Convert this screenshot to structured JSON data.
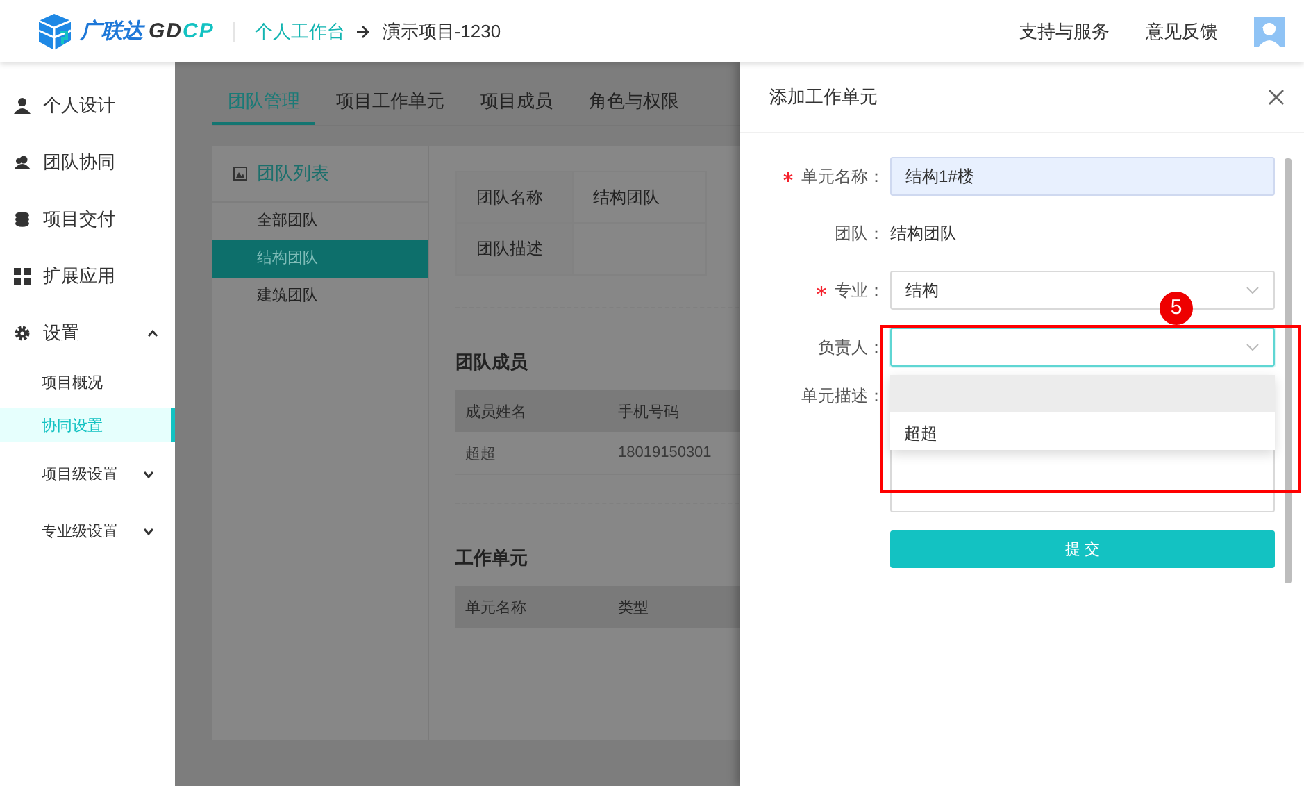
{
  "header": {
    "logo": {
      "brand": "广联达",
      "latin_dark": "GD",
      "latin_accent": "CP"
    },
    "breadcrumb": [
      "个人工作台",
      "演示项目-1230"
    ],
    "links": [
      "支持与服务",
      "意见反馈"
    ]
  },
  "sidebar": {
    "items": [
      {
        "label": "个人设计"
      },
      {
        "label": "团队协同"
      },
      {
        "label": "项目交付"
      },
      {
        "label": "扩展应用"
      },
      {
        "label": "设置",
        "expanded": true,
        "children": [
          {
            "label": "项目概况",
            "selected": false
          },
          {
            "label": "协同设置",
            "selected": true
          },
          {
            "label": "项目级设置",
            "selected": false,
            "expanded": false
          },
          {
            "label": "专业级设置",
            "selected": false,
            "expanded": false
          }
        ]
      }
    ]
  },
  "tabs": [
    {
      "label": "团队管理",
      "selected": true
    },
    {
      "label": "项目工作单元",
      "selected": false
    },
    {
      "label": "项目成员",
      "selected": false
    },
    {
      "label": "角色与权限",
      "selected": false
    }
  ],
  "team_list": {
    "title": "团队列表",
    "items": [
      {
        "label": "全部团队",
        "selected": false
      },
      {
        "label": "结构团队",
        "selected": true
      },
      {
        "label": "建筑团队",
        "selected": false
      }
    ]
  },
  "team_info": [
    {
      "label": "团队名称",
      "value": "结构团队"
    },
    {
      "label": "团队描述"
    }
  ],
  "members": {
    "title": "团队成员",
    "columns": [
      "成员姓名",
      "手机号码"
    ],
    "rows": [
      [
        "超超",
        "18019150301"
      ]
    ]
  },
  "work_units": {
    "title": "工作单元",
    "columns": [
      "单元名称",
      "类型"
    ]
  },
  "drawer": {
    "title": "添加工作单元",
    "fields": [
      {
        "kind": "input",
        "label": "单元名称：",
        "required": true,
        "value": "结构1#楼"
      },
      {
        "kind": "text",
        "label": "团队：",
        "value": "结构团队"
      },
      {
        "kind": "select",
        "label": "专业：",
        "required": true,
        "value": "结构"
      },
      {
        "kind": "select",
        "label": "负责人：",
        "focused": true,
        "options": [
          {
            "highlighted": true
          },
          {
            "label": "超超",
            "highlighted": false
          }
        ]
      },
      {
        "kind": "textarea",
        "label": "单元描述："
      }
    ],
    "submit": "提 交"
  },
  "annotation": {
    "number": "5"
  }
}
